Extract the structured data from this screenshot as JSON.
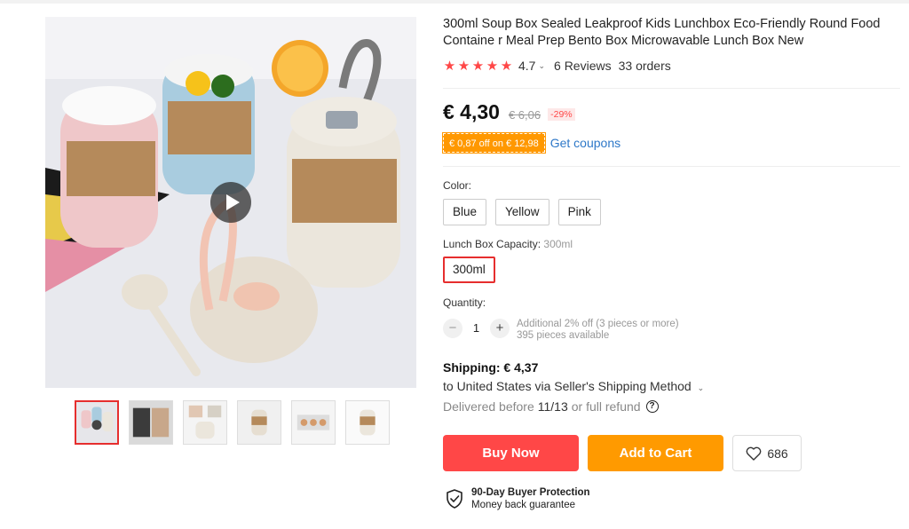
{
  "product": {
    "title": "300ml Soup Box Sealed Leakproof Kids Lunchbox Eco-Friendly Round Food Containe r Meal Prep Bento Box Microwavable Lunch Box New",
    "rating": "4.7",
    "reviews": "6 Reviews",
    "orders": "33 orders",
    "stars": [
      "★",
      "★",
      "★",
      "★",
      "★"
    ]
  },
  "price": {
    "current": "€ 4,30",
    "original": "€ 6,06",
    "discount": "-29%"
  },
  "coupon": {
    "tag": "€ 0,87 off on € 12,98",
    "link": "Get coupons"
  },
  "color": {
    "label": "Color:",
    "options": [
      "Blue",
      "Yellow",
      "Pink"
    ]
  },
  "capacity": {
    "label": "Lunch Box Capacity:",
    "selected_value": "300ml",
    "options": [
      "300ml"
    ]
  },
  "quantity": {
    "label": "Quantity:",
    "minus": "−",
    "plus": "+",
    "value": "1",
    "offer": "Additional 2% off (3 pieces or more)",
    "available": "395 pieces available"
  },
  "shipping": {
    "title": "Shipping: € 4,37",
    "to": "to United States via Seller's Shipping Method",
    "delivered_prefix": "Delivered before",
    "date": "11/13",
    "delivered_suffix": "or full refund",
    "help": "?"
  },
  "actions": {
    "buy_now": "Buy Now",
    "add_to_cart": "Add to Cart",
    "wishlist_count": "686"
  },
  "protection": {
    "title": "90-Day Buyer Protection",
    "subtitle": "Money back guarantee"
  },
  "icons": {
    "play": "play-icon",
    "star": "star-icon",
    "heart": "heart-icon",
    "shield": "shield-check-icon",
    "help": "question-icon"
  },
  "colors": {
    "accent_red": "#ff4747",
    "accent_orange": "#ff9a00",
    "link_blue": "#2e78c8"
  }
}
